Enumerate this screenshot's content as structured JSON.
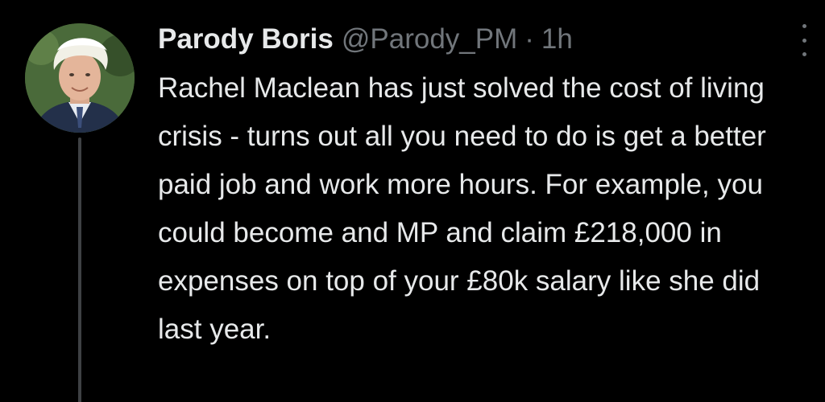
{
  "tweet": {
    "display_name": "Parody Boris",
    "handle": "@Parody_PM",
    "separator": "·",
    "timestamp": "1h",
    "text": "Rachel Maclean has just solved the cost of living crisis - turns out all you need to do is get a better paid job and work more hours. For example, you could become and MP and claim £218,000 in expenses on top of your £80k salary like she did last year."
  },
  "icons": {
    "avatar": "profile-photo",
    "more": "more-vertical-icon"
  },
  "colors": {
    "background": "#000000",
    "primary_text": "#e7e9ea",
    "secondary_text": "#71767b",
    "thread_line": "#3e4144"
  }
}
